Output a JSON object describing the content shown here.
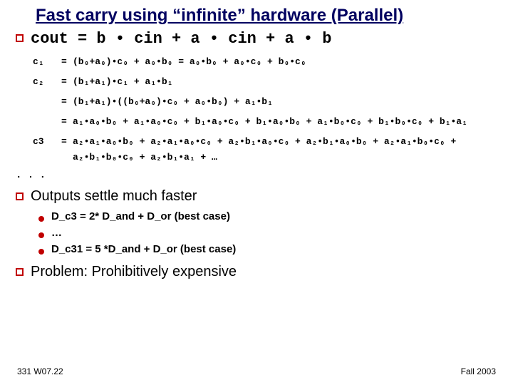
{
  "title": "Fast carry using “infinite” hardware (Parallel)",
  "main_eq": "cout = b • cin + a • cin + a • b",
  "eqs": {
    "c1_lhs": "c₁",
    "c1_rhs": "(b₀+a₀)•c₀ + a₀•b₀    =   a₀•b₀ + a₀•c₀ + b₀•c₀",
    "c2_lhs": "c₂",
    "c2_rhs": "(b₁+a₁)•c₁ + a₁•b₁",
    "c2b_rhs": "(b₁+a₁)•((b₀+a₀)•c₀ + a₀•b₀) + a₁•b₁",
    "c2c_rhs": "a₁•a₀•b₀ + a₁•a₀•c₀ + b₁•a₀•c₀ + b₁•a₀•b₀ + a₁•b₀•c₀ + b₁•b₀•c₀ + b₁•a₁",
    "c3_lhs": "c3",
    "c3_rhs": "a₂•a₁•a₀•b₀ + a₂•a₁•a₀•c₀ + a₂•b₁•a₀•c₀ + a₂•b₁•a₀•b₀ + a₂•a₁•b₀•c₀ + a₂•b₁•b₀•c₀ + a₂•b₁•a₁ + …"
  },
  "ellipsis": ". . .",
  "outputs_line": "Outputs settle much faster",
  "sub": {
    "a": "D_c3 = 2* D_and + D_or (best case)",
    "b": "…",
    "c": "D_c31 = 5 *D_and + D_or (best case)"
  },
  "problem": "Problem: Prohibitively expensive",
  "footer_left": "331 W07.22",
  "footer_right": "Fall 2003"
}
